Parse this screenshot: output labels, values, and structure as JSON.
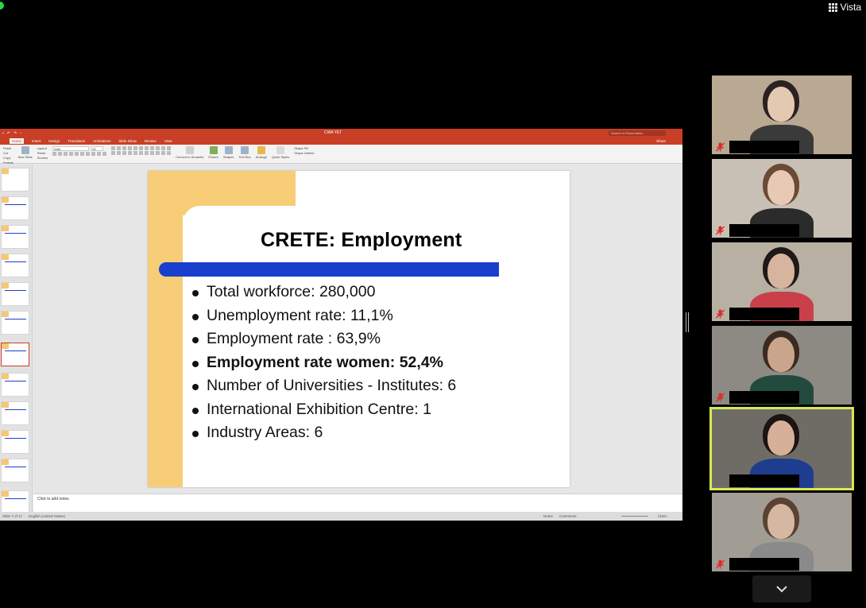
{
  "zoom": {
    "view_label": "Vista"
  },
  "ppt": {
    "doc_title": "CWA YET",
    "search_placeholder": "Search in Presentation",
    "tabs": [
      "Home",
      "Insert",
      "Design",
      "Transitions",
      "Animations",
      "Slide Show",
      "Review",
      "View"
    ],
    "share_label": "Share",
    "ribbon": {
      "paste": "Paste",
      "cut": "Cut",
      "copy": "Copy",
      "format": "Format",
      "new_slide": "New Slide",
      "layout": "Layout",
      "reset": "Reset",
      "section": "Section",
      "font": "Arial",
      "font_size": "28",
      "convert_smartart": "Convert to SmartArt",
      "picture": "Picture",
      "shapes": "Shapes",
      "text_box": "Text Box",
      "arrange": "Arrange",
      "quick_styles": "Quick Styles",
      "shape_fill": "Shape Fill",
      "shape_outline": "Shape Outline"
    },
    "slide": {
      "title": "CRETE: Employment",
      "bullets": [
        "Total workforce: 280,000",
        "Unemployment rate: 11,1%",
        "Employment rate : 63,9%",
        "Employment rate women: 52,4%",
        "Number of Universities - Institutes: 6",
        "International Exhibition Centre: 1",
        "Industry Areas: 6"
      ]
    },
    "notes_placeholder": "Click to add notes",
    "status": {
      "slide_counter": "Slide 7 of 17",
      "language": "English (United States)",
      "notes": "Notes",
      "comments": "Comments",
      "zoom": "216%"
    }
  },
  "participants": [
    {
      "id": "p1",
      "muted": true,
      "bg": "#b9a892",
      "skin": "#e3c9b2",
      "hair": "#2a2220",
      "shirt": "#3b3a3a"
    },
    {
      "id": "p2",
      "muted": true,
      "bg": "#c9c0b5",
      "skin": "#e8c9b6",
      "hair": "#6b4a36",
      "shirt": "#2b2b2b"
    },
    {
      "id": "p3",
      "muted": true,
      "bg": "#b8b1a3",
      "skin": "#d6b49d",
      "hair": "#1f1a18",
      "shirt": "#c9404a"
    },
    {
      "id": "p4",
      "muted": true,
      "bg": "#8d8a83",
      "skin": "#c9a58c",
      "hair": "#3b2a21",
      "shirt": "#234a3e"
    },
    {
      "id": "p5",
      "muted": false,
      "bg": "#6f6c66",
      "skin": "#d7b09a",
      "hair": "#1b1412",
      "shirt": "#1f3d8f"
    },
    {
      "id": "p6",
      "muted": true,
      "bg": "#a19d94",
      "skin": "#d5b7a2",
      "hair": "#5a4131",
      "shirt": "#8a8a8a"
    }
  ]
}
